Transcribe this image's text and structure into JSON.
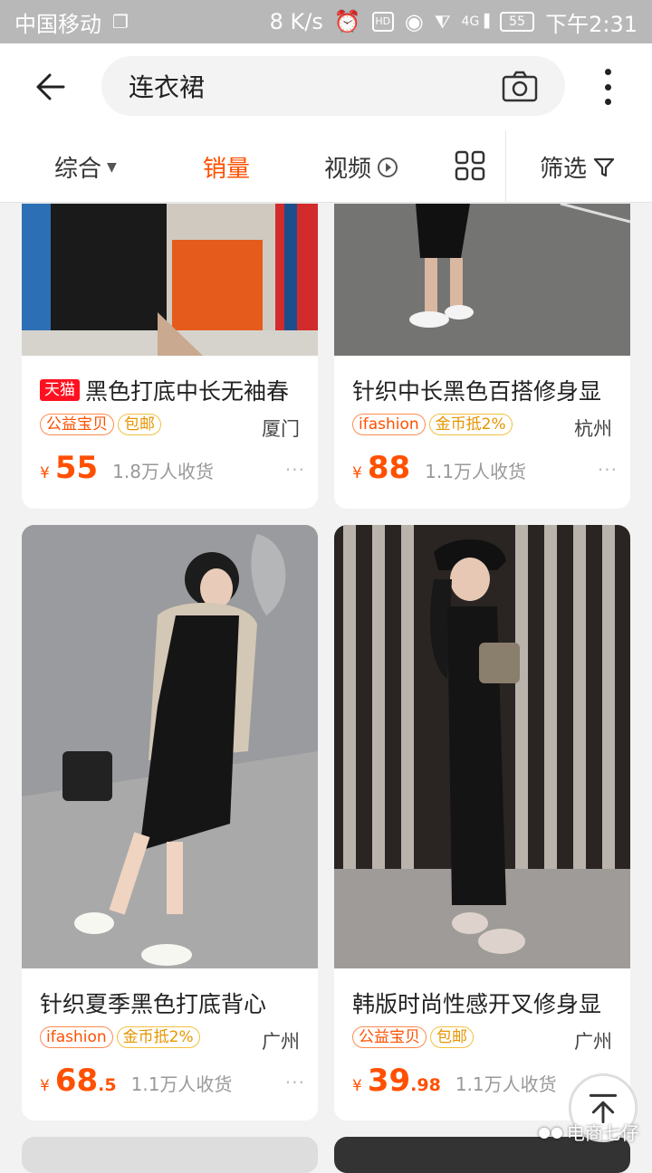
{
  "status_bar": {
    "carrier": "中国移动",
    "speed": "8 K/s",
    "hd": "HD",
    "net": "4G",
    "battery": "55",
    "time": "下午2:31"
  },
  "search": {
    "query": "连衣裙"
  },
  "tabs": [
    {
      "label": "综合"
    },
    {
      "label": "销量"
    },
    {
      "label": "视频"
    },
    {
      "label": "筛选"
    }
  ],
  "products": [
    {
      "badge": "天猫",
      "title": "黑色打底中长无袖春",
      "tags": [
        "公益宝贝",
        "包邮"
      ],
      "city": "厦门",
      "price_int": "55",
      "price_dec": "",
      "sales": "1.8万人收货"
    },
    {
      "title": "针织中长黑色百搭修身显",
      "tags": [
        "ifashion",
        "金币抵2%"
      ],
      "city": "杭州",
      "price_int": "88",
      "price_dec": "",
      "sales": "1.1万人收货"
    },
    {
      "title": "针织夏季黑色打底背心",
      "tags": [
        "ifashion",
        "金币抵2%"
      ],
      "city": "广州",
      "price_int": "68",
      "price_dec": ".5",
      "sales": "1.1万人收货"
    },
    {
      "title": "韩版时尚性感开叉修身显",
      "tags": [
        "公益宝贝",
        "包邮"
      ],
      "city": "广州",
      "price_int": "39",
      "price_dec": ".98",
      "sales": "1.1万人收货"
    }
  ],
  "currency": "¥",
  "more_dots": "···",
  "watermark": "电商七仔",
  "colors": {
    "accent": "#ff5000",
    "tmall": "#ff1020",
    "status_bar": "#b8b8b8"
  }
}
